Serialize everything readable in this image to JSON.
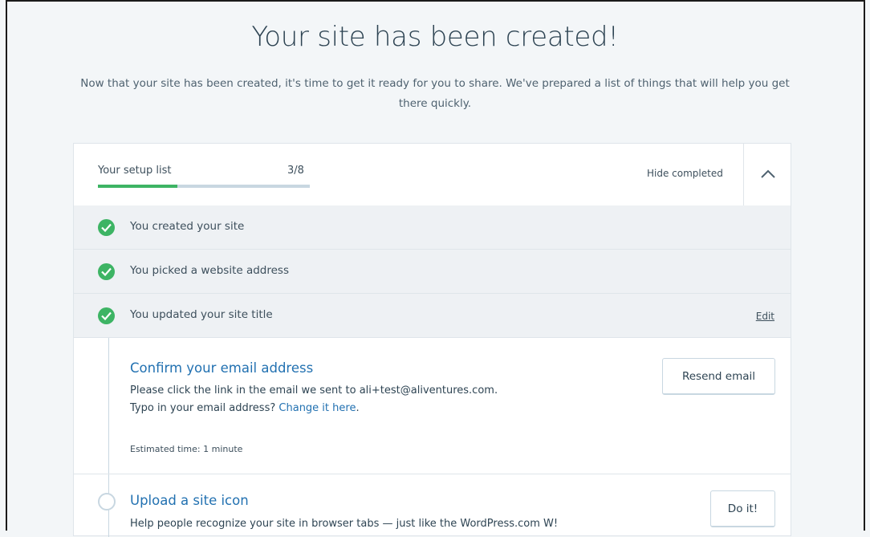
{
  "page": {
    "title": "Your site has been created!",
    "subtitle": "Now that your site has been created, it's time to get it ready for you to share. We've prepared a list of things that will help you get there quickly."
  },
  "setup_list": {
    "label": "Your setup list",
    "count": "3/8",
    "progress": 0.375,
    "hide_completed": "Hide completed",
    "collapse_icon": "chevron-up-icon",
    "completed": [
      {
        "label": "You created your site"
      },
      {
        "label": "You picked a website address"
      },
      {
        "label": "You updated your site title",
        "action": "Edit"
      }
    ],
    "tasks": [
      {
        "title": "Confirm your email address",
        "description_line1": "Please click the link in the email we sent to ali+test@aliventures.com.",
        "description_line2_prefix": "Typo in your email address?",
        "description_line2_link": "Change it here",
        "description_line2_suffix": ".",
        "estimated_time": "Estimated time: 1 minute",
        "button": "Resend email"
      },
      {
        "title": "Upload a site icon",
        "description": "Help people recognize your site in browser tabs — just like the WordPress.com W!",
        "button": "Do it!"
      }
    ]
  },
  "colors": {
    "accent_green": "#3db464",
    "link_blue": "#2271b1",
    "background": "#f3f6f8"
  }
}
